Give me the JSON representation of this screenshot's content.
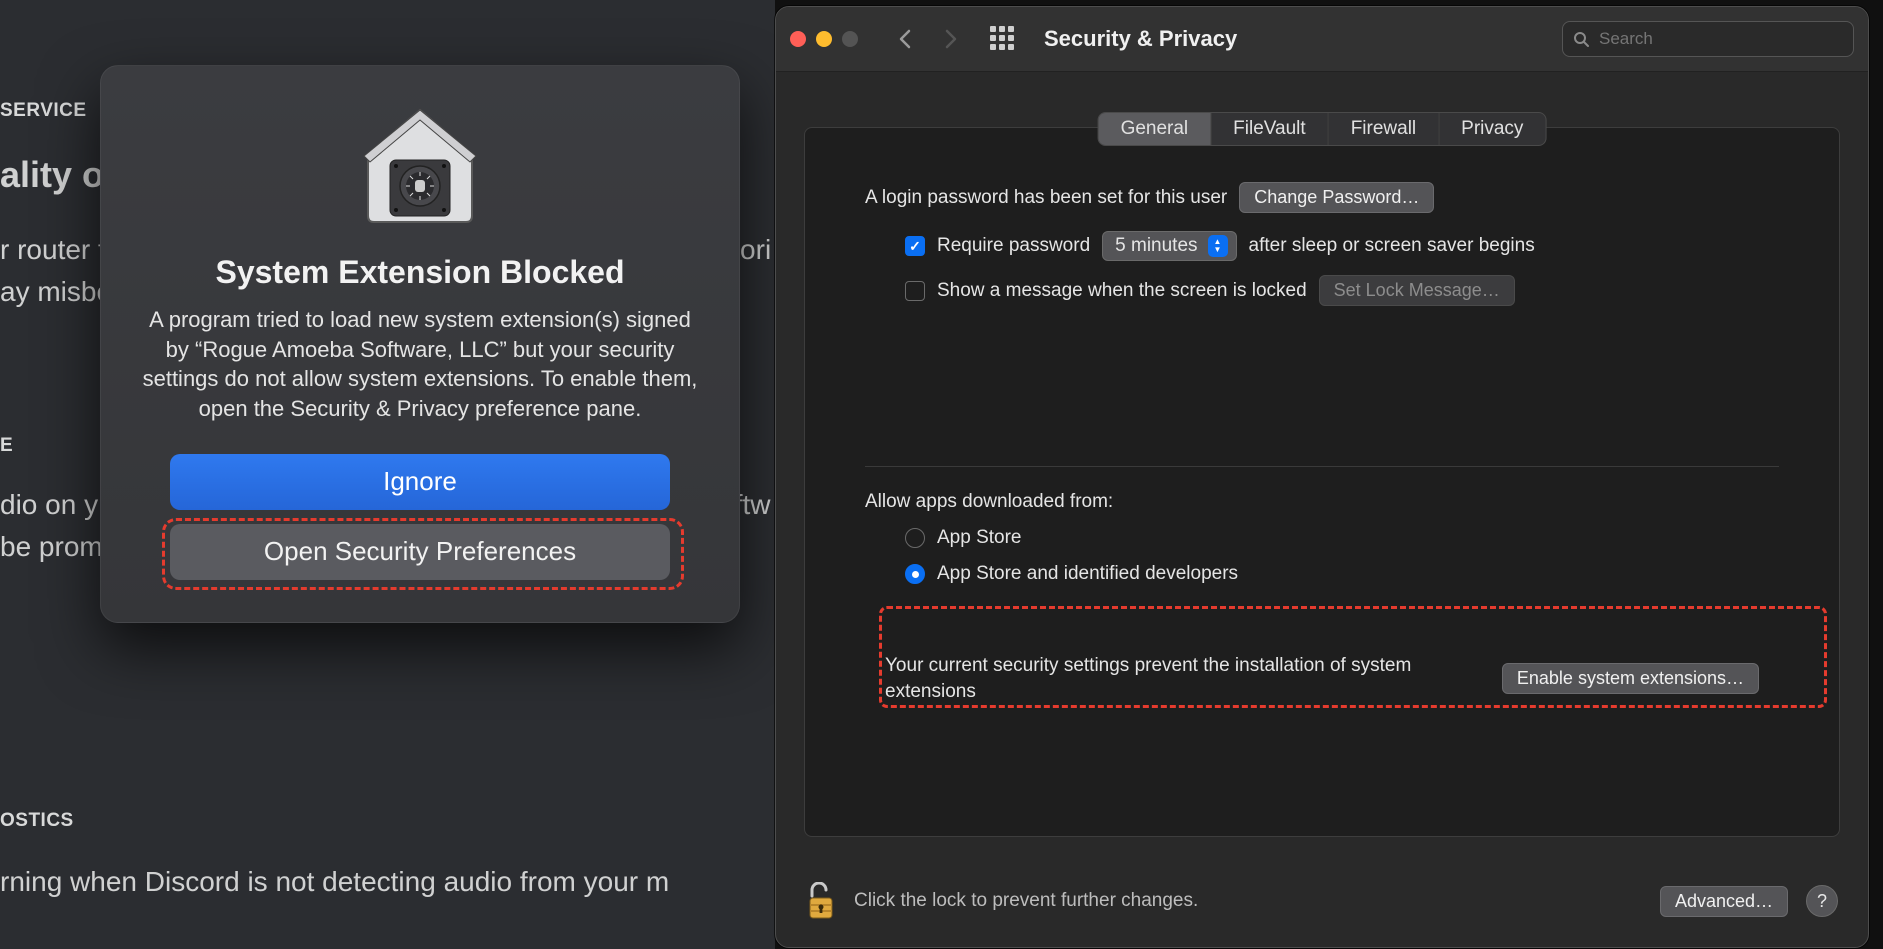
{
  "left": {
    "bg": {
      "section1": "SERVICE",
      "heading1_fragment": "ality of S",
      "body1a": "r router t",
      "body1b_fragment": "gh priori",
      "body1c": "ay misbe",
      "section2_fragment": "E",
      "body2a": "dio on y",
      "body2b_fragment": "nal softw",
      "body2c": " be prom",
      "section3": "OSTICS",
      "body3": "rning when Discord is not detecting audio from your m"
    },
    "modal": {
      "title": "System Extension Blocked",
      "body": "A program tried to load new system extension(s) signed by “Rogue Amoeba Software, LLC” but your security settings do not allow system extensions. To enable them, open the Security & Privacy preference pane.",
      "ignore": "Ignore",
      "open": "Open Security Preferences"
    }
  },
  "right": {
    "title": "Security & Privacy",
    "search_placeholder": "Search",
    "tabs": [
      "General",
      "FileVault",
      "Firewall",
      "Privacy"
    ],
    "active_tab_index": 0,
    "login_pw_text": "A login password has been set for this user",
    "change_pw": "Change Password…",
    "require_pw_label": "Require password",
    "require_pw_checked": true,
    "delay_value": "5 minutes",
    "after_sleep_text": "after sleep or screen saver begins",
    "show_msg_label": "Show a message when the screen is locked",
    "show_msg_checked": false,
    "set_lock_msg": "Set Lock Message…",
    "allow_apps_label": "Allow apps downloaded from:",
    "radios": {
      "app_store": "App Store",
      "identified": "App Store and identified developers",
      "selected": "identified"
    },
    "prevent_text": "Your current security settings prevent the installation of system extensions",
    "enable_btn": "Enable system extensions…",
    "lock_text": "Click the lock to prevent further changes.",
    "advanced": "Advanced…"
  }
}
